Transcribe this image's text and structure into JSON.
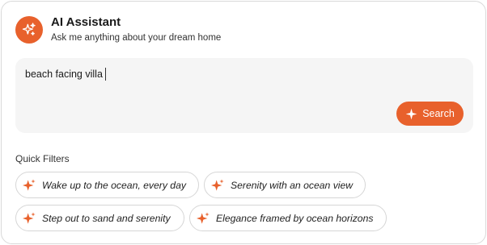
{
  "colors": {
    "accent": "#e8612c",
    "input_bg": "#f5f5f5",
    "border": "#d6d6d6"
  },
  "header": {
    "avatar_icon": "sparkles-icon",
    "title": "AI Assistant",
    "subtitle": "Ask me anything about your dream home"
  },
  "search": {
    "value": "beach facing villa",
    "button_label": "Search",
    "button_icon": "sparkle-icon"
  },
  "quick_filters": {
    "label": "Quick Filters",
    "chips": [
      {
        "label": "Wake up to the ocean, every day",
        "icon": "sparkle-icon"
      },
      {
        "label": "Serenity with an ocean view",
        "icon": "sparkle-icon"
      },
      {
        "label": "Step out to sand and serenity",
        "icon": "sparkle-icon"
      },
      {
        "label": "Elegance framed by ocean horizons",
        "icon": "sparkle-icon"
      }
    ]
  }
}
